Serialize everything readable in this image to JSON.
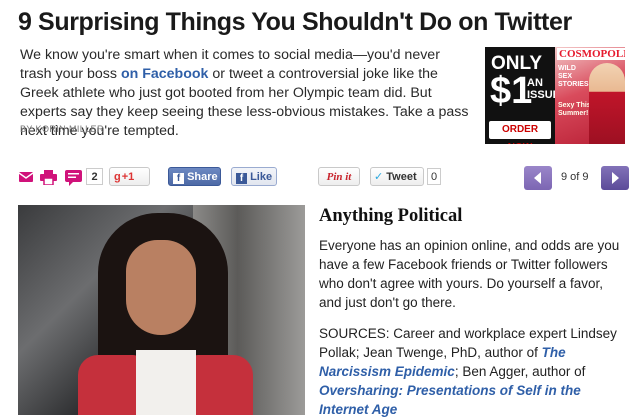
{
  "article": {
    "title": "9 Surprising Things You Shouldn't Do on Twitter",
    "intro_before": "We know you're smart when it comes to social media—you'd never trash your boss ",
    "intro_link": "on Facebook",
    "intro_after": " or tweet a controversial joke like the Greek athlete who just got booted from her Olympic team did. But experts say they keep seeing these less-obvious mistakes. Take a pass next time you're tempted.",
    "byline": "BY KORIN MILLER"
  },
  "ad": {
    "only": "ONLY",
    "price": "$1",
    "an_issue": "AN ISSUE",
    "order_now": "ORDER NOW",
    "masthead": "COSMOPOLITAN",
    "cover_line_1": "WILD SEX STORIES",
    "cover_line_2": "Sexy This Summer!"
  },
  "toolbar": {
    "comment_count": "2",
    "gplus_label": "+1",
    "fb_share_label": "Share",
    "fb_like_label": "Like",
    "pinit_label": "Pin it",
    "tweet_label": "Tweet",
    "tweet_count": "0",
    "pager": "9 of 9",
    "colors": {
      "accent_magenta": "#d0127a",
      "facebook_blue": "#3b5998",
      "pager_purple": "#7c66b3"
    }
  },
  "slide": {
    "title": "Anything Political",
    "body": "Everyone has an opinion online, and odds are you have a few Facebook friends or Twitter followers who don't agree with yours. Do yourself a favor, and just don't go there.",
    "sources_prefix": "SOURCES: Career and workplace expert Lindsey Pollak; Jean Twenge, PhD, author of ",
    "book1": "The Narcissism Epidemic",
    "sources_mid": "; Ben Agger, author of ",
    "book2": "Oversharing: Presentations of Self in the Internet Age"
  }
}
